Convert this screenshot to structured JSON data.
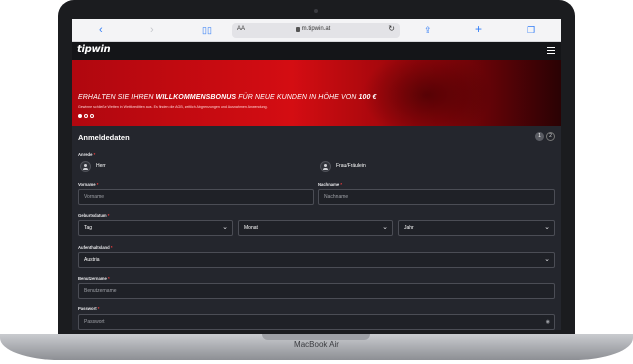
{
  "device": {
    "label": "MacBook Air"
  },
  "browser": {
    "url": "m.tipwin.at",
    "text_size_label": "AA",
    "icons": [
      "chevron-left-icon",
      "chevron-right-icon",
      "book-icon",
      "share-icon",
      "plus-icon",
      "tabs-icon"
    ]
  },
  "header": {
    "logo": "tipwin"
  },
  "hero": {
    "title_prefix": "ERHALTEN SIE IHREN",
    "title_bold": "WILLKOMMENSBONUS",
    "title_mid": "FÜR NEUE KUNDEN IN HÖHE VON",
    "title_amount": "100 €",
    "subtitle": "Gewinne schließe Wetten in Wettkreditten aus. Es finden die AGB, zeitlich Abgrenzungen und Ausnahmen Anwendung."
  },
  "form": {
    "title": "Anmeldedaten",
    "steps": [
      "1",
      "2"
    ],
    "salutation": {
      "label": "Anrede",
      "options": [
        "Herr",
        "Frau/Fräulein"
      ]
    },
    "first_name": {
      "label": "Vorname",
      "placeholder": "Vorname"
    },
    "last_name": {
      "label": "Nachname",
      "placeholder": "Nachname"
    },
    "birthdate": {
      "label": "Geburtsdatum",
      "day": "Tag",
      "month": "Monat",
      "year": "Jahr"
    },
    "country": {
      "label": "Aufenthaltsland",
      "value": "Austria"
    },
    "username": {
      "label": "Benutzername",
      "placeholder": "Benutzername"
    },
    "password": {
      "label": "Passwort",
      "placeholder": "Passwort"
    },
    "required_marker": "*"
  },
  "colors": {
    "brand_red": "#d40d12",
    "background": "#24262d",
    "required": "#ff3b3b"
  }
}
